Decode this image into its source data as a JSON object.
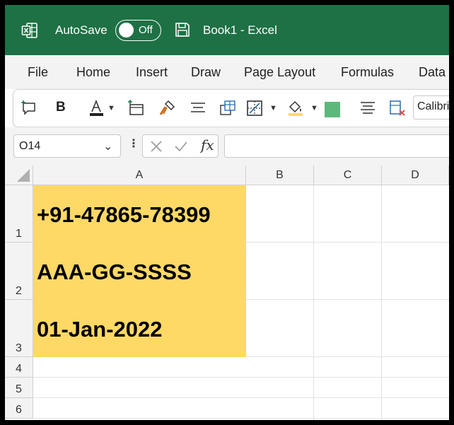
{
  "titlebar": {
    "autosave_label": "AutoSave",
    "autosave_state": "Off",
    "document_title": "Book1  -  Excel"
  },
  "menu": {
    "items": [
      "File",
      "Home",
      "Insert",
      "Draw",
      "Page Layout",
      "Formulas",
      "Data"
    ]
  },
  "ribbon": {
    "bold_label": "B",
    "font_name": "Calibri",
    "fill_color": "#5db97b",
    "highlight_color": "#ffd966"
  },
  "formula_bar": {
    "name_box": "O14",
    "fx_label": "fx",
    "formula": ""
  },
  "grid": {
    "columns": [
      "A",
      "B",
      "C",
      "D"
    ],
    "rows": [
      "1",
      "2",
      "3",
      "4",
      "5",
      "6"
    ],
    "cells": {
      "A1": "+91-47865-78399",
      "A2": "AAA-GG-SSSS",
      "A3": "01-Jan-2022"
    },
    "cell_fill": "#ffd966"
  },
  "colors": {
    "titlebar": "#1e7145",
    "menu_bg": "#f3f3f3"
  }
}
